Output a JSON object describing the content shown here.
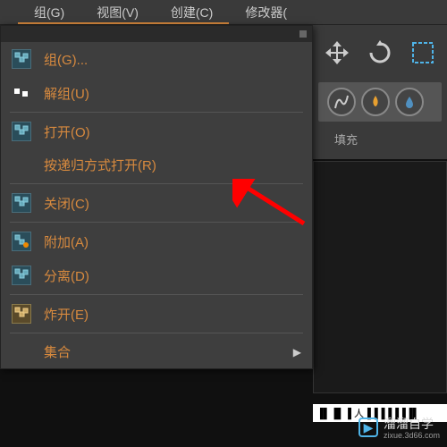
{
  "menubar": {
    "items": [
      {
        "label": "组(G)"
      },
      {
        "label": "视图(V)"
      },
      {
        "label": "创建(C)"
      },
      {
        "label": "修改器("
      }
    ]
  },
  "dropdown": {
    "items": [
      {
        "label": "组(G)...",
        "icon": "group"
      },
      {
        "label": "解组(U)",
        "icon": "squares"
      },
      {
        "label": "打开(O)",
        "icon": "group"
      },
      {
        "label": "按递归方式打开(R)",
        "icon": "none"
      },
      {
        "label": "关闭(C)",
        "icon": "group"
      },
      {
        "label": "附加(A)",
        "icon": "group-plus"
      },
      {
        "label": "分离(D)",
        "icon": "group"
      },
      {
        "label": "炸开(E)",
        "icon": "group-special"
      },
      {
        "label": "集合",
        "icon": "none",
        "submenu": true
      }
    ]
  },
  "toolbar": {
    "fill_label": "填充"
  },
  "bottom": {
    "text": "▐▌▐▌▐ 人▐▐▐▐▐▐▐▌"
  },
  "watermark": {
    "brand": "溜溜自学",
    "url": "zixue.3d66.com"
  }
}
